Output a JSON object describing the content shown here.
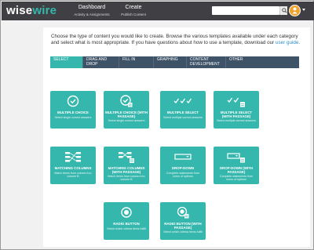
{
  "colors": {
    "topbar": "#3f3f44",
    "accent": "#36b7ad",
    "tabs": "#3f5368",
    "avatar": "#f0a22a",
    "link": "#2c8fc7"
  },
  "header": {
    "logo_part1": "wise",
    "logo_part2": "wire",
    "nav": [
      {
        "label": "Dashboard",
        "sub": "Activity & Assignments"
      },
      {
        "label": "Create",
        "sub": "Publish Content"
      }
    ],
    "search": {
      "value": "",
      "placeholder": ""
    },
    "search_icon": "search-icon",
    "avatar_icon": "user-icon"
  },
  "intro": {
    "text": "Choose the type of content you would like to create. Browse the various templates available under each category and select what is most appropriate. If you have questions about how to use a template, download our ",
    "link": "user guide",
    "end": "."
  },
  "tabs": [
    {
      "label": "SELECT",
      "active": true
    },
    {
      "label": "DRAG AND DROP",
      "active": false
    },
    {
      "label": "FILL IN",
      "active": false
    },
    {
      "label": "GRAPHING",
      "active": false
    },
    {
      "label": "CONTENT DEVELOPMENT",
      "active": false
    },
    {
      "label": "OTHER",
      "active": false
    }
  ],
  "templates": [
    {
      "name": "MULTIPLE CHOICE",
      "desc": "Select single correct answers",
      "icon": "single-check-icon"
    },
    {
      "name": "MULTIPLE CHOICE (WITH PASSAGE)",
      "desc": "Select single correct answers",
      "icon": "single-check-passage-icon"
    },
    {
      "name": "MULTIPLE SELECT",
      "desc": "Select multiple correct answers",
      "icon": "multi-check-icon"
    },
    {
      "name": "MULTIPLE SELECT (WITH PASSAGE)",
      "desc": "Select multiple correct answers",
      "icon": "multi-check-passage-icon"
    },
    {
      "name": "MATCHING COLUMNS",
      "desc": "Match items from column A to column B",
      "icon": "matching-columns-icon"
    },
    {
      "name": "MATCHING COLUMNS (WITH PASSAGE)",
      "desc": "Match items from column A to column B",
      "icon": "matching-columns-passage-icon"
    },
    {
      "name": "DROP-DOWN",
      "desc": "Complete statements from menu of options",
      "icon": "dropdown-icon"
    },
    {
      "name": "DROP-DOWN (WITH PASSAGE)",
      "desc": "Complete statements from menu of options",
      "icon": "dropdown-passage-icon"
    },
    {
      "name": "RADIO BUTTON",
      "desc": "Select which criteria items fulfill",
      "icon": "radio-button-icon"
    },
    {
      "name": "RADIO BUTTON (WITH PASSAGE)",
      "desc": "Select which criteria items fulfill",
      "icon": "radio-button-passage-icon"
    }
  ]
}
